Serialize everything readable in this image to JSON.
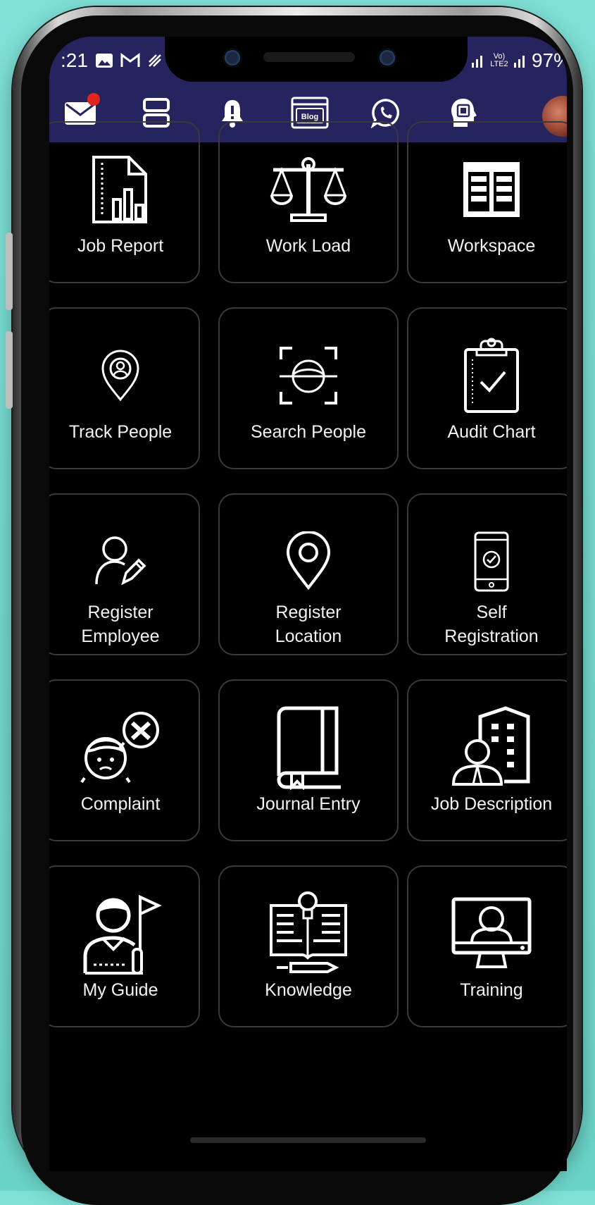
{
  "status": {
    "time": ":21",
    "left_icons": [
      "gallery-icon",
      "gmail-icon",
      "wifi-calling-icon"
    ],
    "network": "Vo) LTE2",
    "battery": "97%"
  },
  "appbar": {
    "icons": [
      "mail-icon",
      "menu-grid-icon",
      "bell-icon",
      "blog-icon",
      "whatsapp-icon",
      "ai-head-icon"
    ],
    "blog_text": "Blog"
  },
  "tiles": [
    {
      "label": "Job Report",
      "icon": "job-report-icon"
    },
    {
      "label": "Work Load",
      "icon": "scale-icon"
    },
    {
      "label": "Workspace",
      "icon": "workspace-icon"
    },
    {
      "label": "Track People",
      "icon": "track-pin-icon"
    },
    {
      "label": "Search People",
      "icon": "face-scan-icon"
    },
    {
      "label": "Audit Chart",
      "icon": "clipboard-check-icon"
    },
    {
      "label": "Register\nEmployee",
      "icon": "user-edit-icon"
    },
    {
      "label": "Register\nLocation",
      "icon": "location-pin-icon"
    },
    {
      "label": "Self\nRegistration",
      "icon": "phone-check-icon"
    },
    {
      "label": "Complaint",
      "icon": "complaint-icon"
    },
    {
      "label": "Journal Entry",
      "icon": "journal-book-icon"
    },
    {
      "label": "Job Description",
      "icon": "building-person-icon"
    },
    {
      "label": "My Guide",
      "icon": "guide-flag-icon"
    },
    {
      "label": "Knowledge",
      "icon": "knowledge-book-icon"
    },
    {
      "label": "Training",
      "icon": "training-monitor-icon"
    }
  ],
  "colors": {
    "bar": "#26245e",
    "tile_border": "#3a3a3a",
    "badge": "#e1251b"
  }
}
